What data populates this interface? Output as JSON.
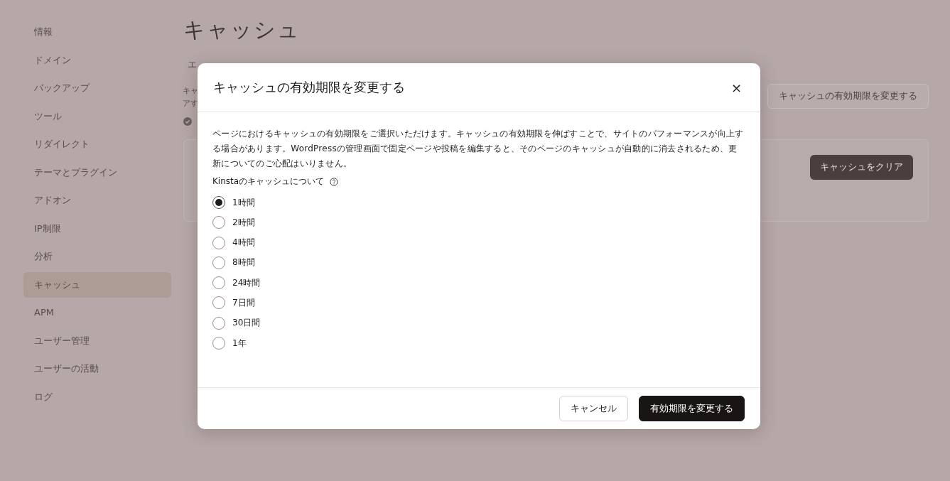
{
  "sidebar": {
    "items": [
      {
        "label": "情報",
        "selected": false
      },
      {
        "label": "ドメイン",
        "selected": false
      },
      {
        "label": "バックアップ",
        "selected": false
      },
      {
        "label": "ツール",
        "selected": false
      },
      {
        "label": "リダイレクト",
        "selected": false
      },
      {
        "label": "テーマとプラグイン",
        "selected": false
      },
      {
        "label": "アドオン",
        "selected": false
      },
      {
        "label": "IP制限",
        "selected": false
      },
      {
        "label": "分析",
        "selected": false
      },
      {
        "label": "キャッシュ",
        "selected": true
      },
      {
        "label": "APM",
        "selected": false
      },
      {
        "label": "ユーザー管理",
        "selected": false
      },
      {
        "label": "ユーザーの活動",
        "selected": false
      },
      {
        "label": "ログ",
        "selected": false
      }
    ]
  },
  "page": {
    "title": "キャッシュ",
    "tab_fragment": "エ",
    "description_lines": [
      "キャ",
      "アす"
    ],
    "change_expiry_button": "キャッシュの有効期限を変更する",
    "clear_cache_button": "キャッシュをクリア"
  },
  "modal": {
    "title": "キャッシュの有効期限を変更する",
    "close": "×",
    "description": "ページにおけるキャッシュの有効期限をご選択いただけます。キャッシュの有効期限を伸ばすことで、サイトのパフォーマンスが向上する場合があります。WordPressの管理画面で固定ページや投稿を編集すると、そのページのキャッシュが自動的に消去されるため、更新についてのご心配はいりません。",
    "help_label": "Kinstaのキャッシュについて",
    "options": [
      {
        "label": "1時間",
        "selected": true
      },
      {
        "label": "2時間",
        "selected": false
      },
      {
        "label": "4時間",
        "selected": false
      },
      {
        "label": "8時間",
        "selected": false
      },
      {
        "label": "24時間",
        "selected": false
      },
      {
        "label": "7日間",
        "selected": false
      },
      {
        "label": "30日間",
        "selected": false
      },
      {
        "label": "1年",
        "selected": false
      }
    ],
    "buttons": [
      {
        "label": "キャンセル",
        "kind": "secondary"
      },
      {
        "label": "有効期限を変更する",
        "kind": "primary"
      }
    ]
  }
}
